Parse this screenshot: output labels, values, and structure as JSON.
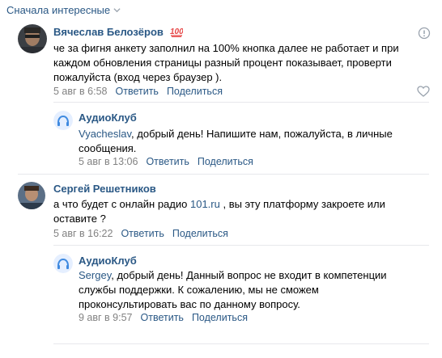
{
  "sort": {
    "label": "Сначала интересные"
  },
  "comments": [
    {
      "author": "Вячеслав Белозёров",
      "badge": "100",
      "text": "че за фигня анкету заполнил на 100% кнопка далее не работает и при каждом обновления страницы разный процент показывает, проверти пожалуйста (вход через браузер ).",
      "date": "5 авг в 6:58",
      "reply_label": "Ответить",
      "share_label": "Поделиться",
      "reply": {
        "author": "АудиоКлуб",
        "mention": "Vyacheslav",
        "text": ", добрый день! Напишите нам, пожалуйста, в личные сообщения.",
        "date": "5 авг в 13:06",
        "reply_label": "Ответить",
        "share_label": "Поделиться"
      }
    },
    {
      "author": "Сергей Решетников",
      "text_before": "а что будет с онлайн радио ",
      "link": "101.ru",
      "text_after": " , вы эту платформу закроете или оставите ?",
      "date": "5 авг в 16:22",
      "reply_label": "Ответить",
      "share_label": "Поделиться",
      "reply": {
        "author": "АудиоКлуб",
        "mention": "Sergey",
        "text": ", добрый день! Данный вопрос не входит в компетенции службы поддержки. К сожалению, мы не сможем проконсультировать вас по данному вопросу.",
        "date": "9 авг в 9:57",
        "reply_label": "Ответить",
        "share_label": "Поделиться"
      }
    }
  ],
  "colors": {
    "link": "#2a5885",
    "meta": "#828282",
    "brand": "#3f8ae0",
    "badge": "#e64646"
  }
}
